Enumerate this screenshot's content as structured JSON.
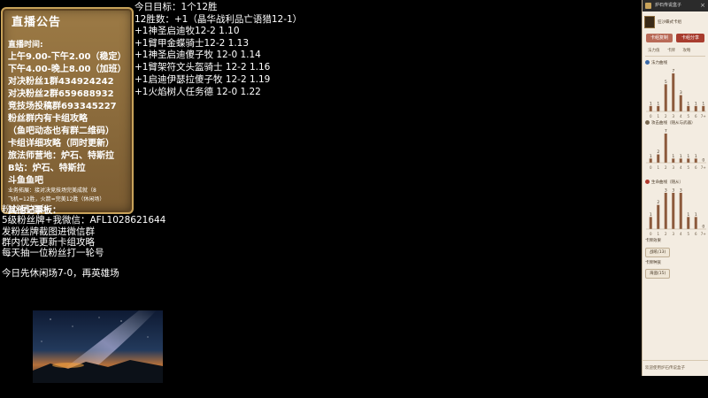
{
  "board": {
    "title": "直播公告",
    "lines": [
      "直播时间:",
      "上午9.00-下午2.00（稳定）",
      "下午4.00-晚上8.00（加班）",
      "对决粉丝1群434924242",
      "对决粉丝2群659688932",
      "竞技场投稿群693345227",
      "粉丝群内有卡组攻略",
      "（鱼吧动态也有群二维码）",
      "卡组详细攻略（同时更新）",
      "旅法师营地：炉石、特斯拉",
      "B站：炉石、特斯拉",
      "斗鱼鱼吧",
      "业务拓展：接对决竞技场完美成就（8",
      "飞机=12胜，火箭=完美12胜（休闲场）",
      "其他记事板："
    ]
  },
  "overlay": [
    "粉丝团福利",
    "5级粉丝牌+我微信：AFL1028621644",
    "发粉丝牌截图进微信群",
    "群内优先更新卡组攻略",
    "每天抽一位粉丝打一轮号"
  ],
  "note": "今日先休闲场7-0，再英雄场",
  "goals": [
    "今日目标：1个12胜",
    "12胜数：+1（晶华战利品亡语猎12-1）",
    "+1神圣启迪牧12-2  1.10",
    "+1臂甲金蝶骑士12-2 1.13",
    "+1神圣启迪傻子牧 12-0 1.14",
    "+1臂架符文头盔骑士 12-2 1.16",
    "+1启迪伊瑟拉傻子牧 12-2 1.19",
    "+1火焰树人任务德 12-0 1.22"
  ],
  "tracker": {
    "title": "炉石传说盒子",
    "close": "×",
    "deck_name": "狂沙蝶式卡组",
    "btn_copy": "卡组复制",
    "btn_share": "卡组分享",
    "tabs": [
      "法力值",
      "卡牌",
      "攻略"
    ],
    "sections": [
      {
        "title": "法力曲线",
        "icon_color": "#3b6aa8",
        "values": [
          1,
          1,
          5,
          7,
          3,
          1,
          1,
          1
        ]
      },
      {
        "title": "攻击曲线（随从与武器）",
        "icon_color": "#7a6a52",
        "values": [
          1,
          2,
          7,
          1,
          1,
          1,
          1,
          0
        ]
      },
      {
        "title": "生命曲线（随从）",
        "icon_color": "#b03a2e",
        "values": [
          1,
          2,
          3,
          3,
          3,
          1,
          1,
          0
        ]
      }
    ],
    "ticks": [
      "0",
      "1",
      "2",
      "3",
      "4",
      "5",
      "6",
      "7+"
    ],
    "card_effects_title": "卡牌效果",
    "card_effects_pill": "战吼(13)",
    "card_type_title": "卡牌种族",
    "card_type_pill": "海盗(15)",
    "footer": "欢迎使用炉石传说盒子"
  }
}
